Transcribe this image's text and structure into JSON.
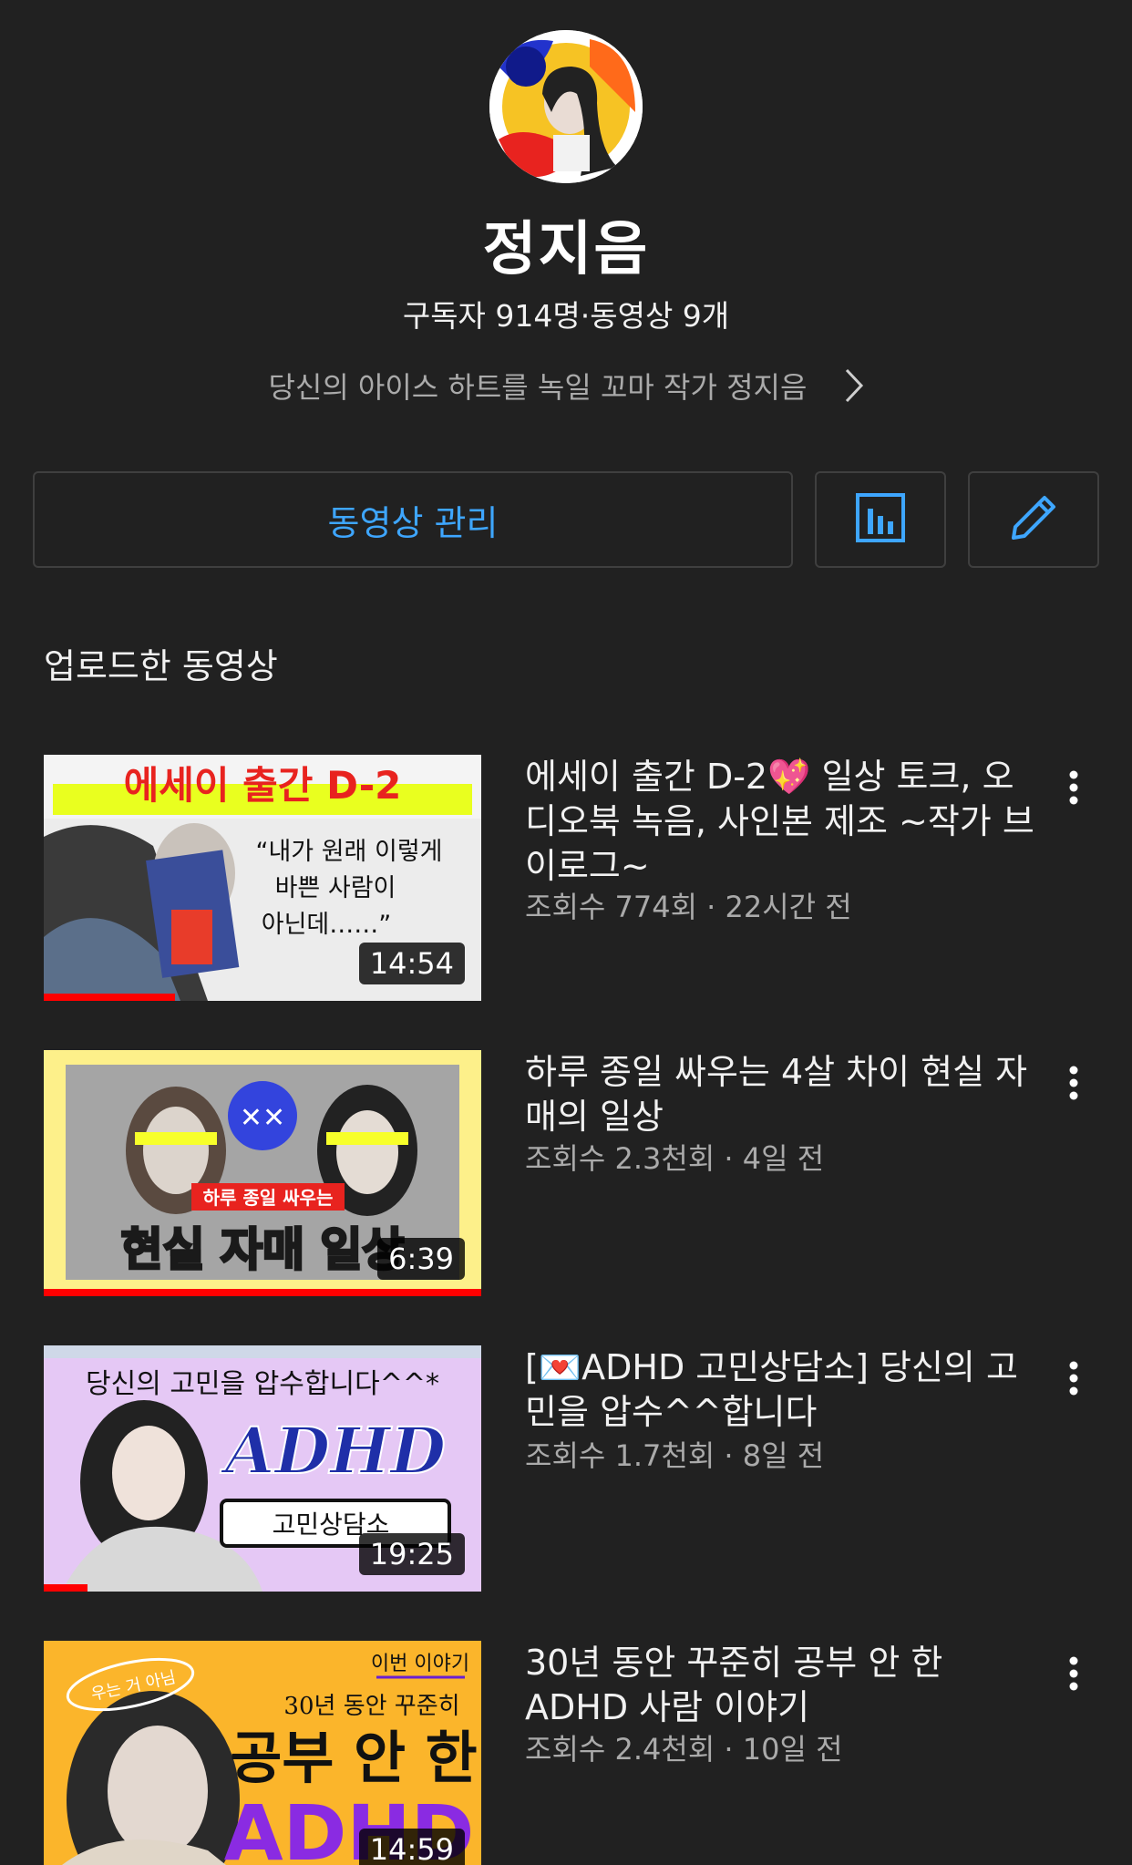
{
  "channel": {
    "name": "정지음",
    "stats": "구독자 914명·동영상 9개",
    "description": "당신의 아이스 하트를 녹일 꼬마 작가 정지음"
  },
  "actions": {
    "manage_label": "동영상 관리",
    "stats_icon": "bar-chart-icon",
    "edit_icon": "pencil-icon"
  },
  "section": {
    "title": "업로드한 동영상"
  },
  "colors": {
    "accent": "#3ea6ff",
    "background": "#212121",
    "progress": "#ff0000"
  },
  "videos": [
    {
      "title": "에세이 출간 D-2💖 일상 토크, 오디오북 녹음, 사인본 제조 ~작가 브이로그~",
      "meta": "조회수 774회 · 22시간 전",
      "duration": "14:54",
      "watched_fraction": 0.3,
      "thumb_text": {
        "banner": "에세이 출간 D-2",
        "quote1": "“내가 원래 이렇게",
        "quote2": "바쁜 사람이",
        "quote3": "아닌데……”"
      }
    },
    {
      "title": "하루 종일 싸우는 4살 차이 현실 자매의 일상",
      "meta": "조회수 2.3천회 · 4일 전",
      "duration": "6:39",
      "watched_fraction": 1.0,
      "thumb_text": {
        "small": "하루 종일 싸우는",
        "big": "현실 자매 일상"
      }
    },
    {
      "title": "[💌ADHD 고민상담소] 당신의 고민을 압수^^합니다",
      "meta": "조회수 1.7천회 · 8일 전",
      "duration": "19:25",
      "watched_fraction": 0.1,
      "thumb_text": {
        "top": "당신의 고민을 압수합니다^^*",
        "big": "ADHD",
        "box": "고민상담소"
      }
    },
    {
      "title": "30년 동안 꾸준히 공부 안 한 ADHD 사람 이야기",
      "meta": "조회수 2.4천회 · 10일 전",
      "duration": "14:59",
      "watched_fraction": 0,
      "thumb_text": {
        "tag": "이번 이야기",
        "sticker": "우는 거 아님",
        "line1": "30년 동안 꾸준히",
        "line2": "공부 안 한",
        "line3": "ADHD"
      }
    }
  ]
}
